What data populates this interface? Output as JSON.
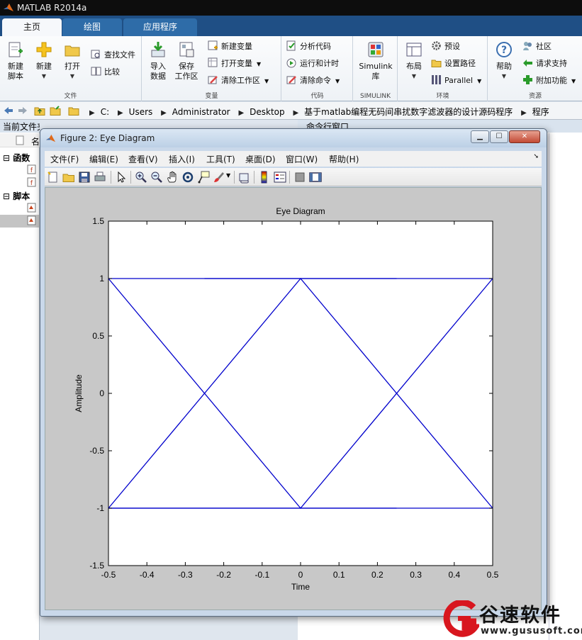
{
  "app": {
    "title": "MATLAB R2014a"
  },
  "tabs": [
    {
      "label": "主页",
      "active": true
    },
    {
      "label": "绘图",
      "active": false
    },
    {
      "label": "应用程序",
      "active": false
    }
  ],
  "ribbon": {
    "file": {
      "group_label": "文件",
      "new_script": "新建\n脚本",
      "new": "新建",
      "open": "打开",
      "find_files": "查找文件",
      "compare": "比较"
    },
    "variable": {
      "group_label": "变量",
      "import_data": "导入\n数据",
      "save_workspace": "保存\n工作区",
      "new_variable": "新建变量",
      "open_variable": "打开变量",
      "clear_workspace": "清除工作区"
    },
    "code": {
      "group_label": "代码",
      "analyze_code": "分析代码",
      "run_and_time": "运行和计时",
      "clear_commands": "清除命令"
    },
    "simulink": {
      "group_label": "SIMULINK",
      "simulink_library": "Simulink\n库"
    },
    "environment": {
      "group_label": "环境",
      "layout": "布局",
      "preferences": "预设",
      "set_path": "设置路径",
      "parallel": "Parallel"
    },
    "resources": {
      "group_label": "资源",
      "help": "帮助",
      "community": "社区",
      "request_support": "请求支持",
      "add_ons": "附加功能"
    }
  },
  "address": {
    "crumbs": [
      "C:",
      "Users",
      "Administrator",
      "Desktop",
      "基于matlab编程无码间串扰数字滤波器的设计源码程序",
      "程序"
    ]
  },
  "left_panel": {
    "title": "当前文件夹",
    "col_header": "名",
    "nodes": [
      "函数",
      "脚本"
    ]
  },
  "right_panel": {
    "title": "命令行窗口"
  },
  "figure": {
    "title": "Figure 2: Eye Diagram",
    "menu": [
      "文件(F)",
      "编辑(E)",
      "查看(V)",
      "插入(I)",
      "工具(T)",
      "桌面(D)",
      "窗口(W)",
      "帮助(H)"
    ],
    "toolbar_icons": [
      "new-figure-icon",
      "open-icon",
      "save-icon",
      "print-icon",
      "select-arrow-icon",
      "zoom-in-icon",
      "zoom-out-icon",
      "pan-hand-icon",
      "rotate-3d-icon",
      "data-cursor-icon",
      "brush-icon",
      "link-plot-icon",
      "colorbar-icon",
      "legend-icon",
      "hide-plot-tools-icon",
      "show-plot-tools-icon"
    ]
  },
  "chart_data": {
    "type": "line",
    "title": "Eye Diagram",
    "xlabel": "Time",
    "ylabel": "Amplitude",
    "xlim": [
      -0.5,
      0.5
    ],
    "ylim": [
      -1.5,
      1.5
    ],
    "xticks": [
      -0.5,
      -0.4,
      -0.3,
      -0.2,
      -0.1,
      0,
      0.1,
      0.2,
      0.3,
      0.4,
      0.5
    ],
    "xticklabels": [
      "-0.5",
      "-0.4",
      "-0.3",
      "-0.2",
      "-0.1",
      "0",
      "0.1",
      "0.2",
      "0.3",
      "0.4",
      "0.5"
    ],
    "yticks": [
      -1.5,
      -1,
      -0.5,
      0,
      0.5,
      1,
      1.5
    ],
    "yticklabels": [
      "-1.5",
      "-1",
      "-0.5",
      "0",
      "0.5",
      "1",
      "1.5"
    ],
    "grid": false,
    "line_color": "#0000cc",
    "series": [
      {
        "x": [
          -0.5,
          0.5
        ],
        "y": [
          1,
          1
        ]
      },
      {
        "x": [
          -0.5,
          0.5
        ],
        "y": [
          -1,
          -1
        ]
      },
      {
        "x": [
          -0.25,
          0.25
        ],
        "y": [
          1,
          1
        ]
      },
      {
        "x": [
          -0.5,
          0.25
        ],
        "y": [
          -1,
          -1
        ]
      },
      {
        "x": [
          -0.5,
          0,
          0.5
        ],
        "y": [
          1,
          -1,
          1
        ]
      },
      {
        "x": [
          -0.5,
          0,
          0.5
        ],
        "y": [
          -1,
          1,
          -1
        ]
      }
    ]
  },
  "watermark": {
    "brand": "谷速软件",
    "url": "www.gususoft.com"
  }
}
